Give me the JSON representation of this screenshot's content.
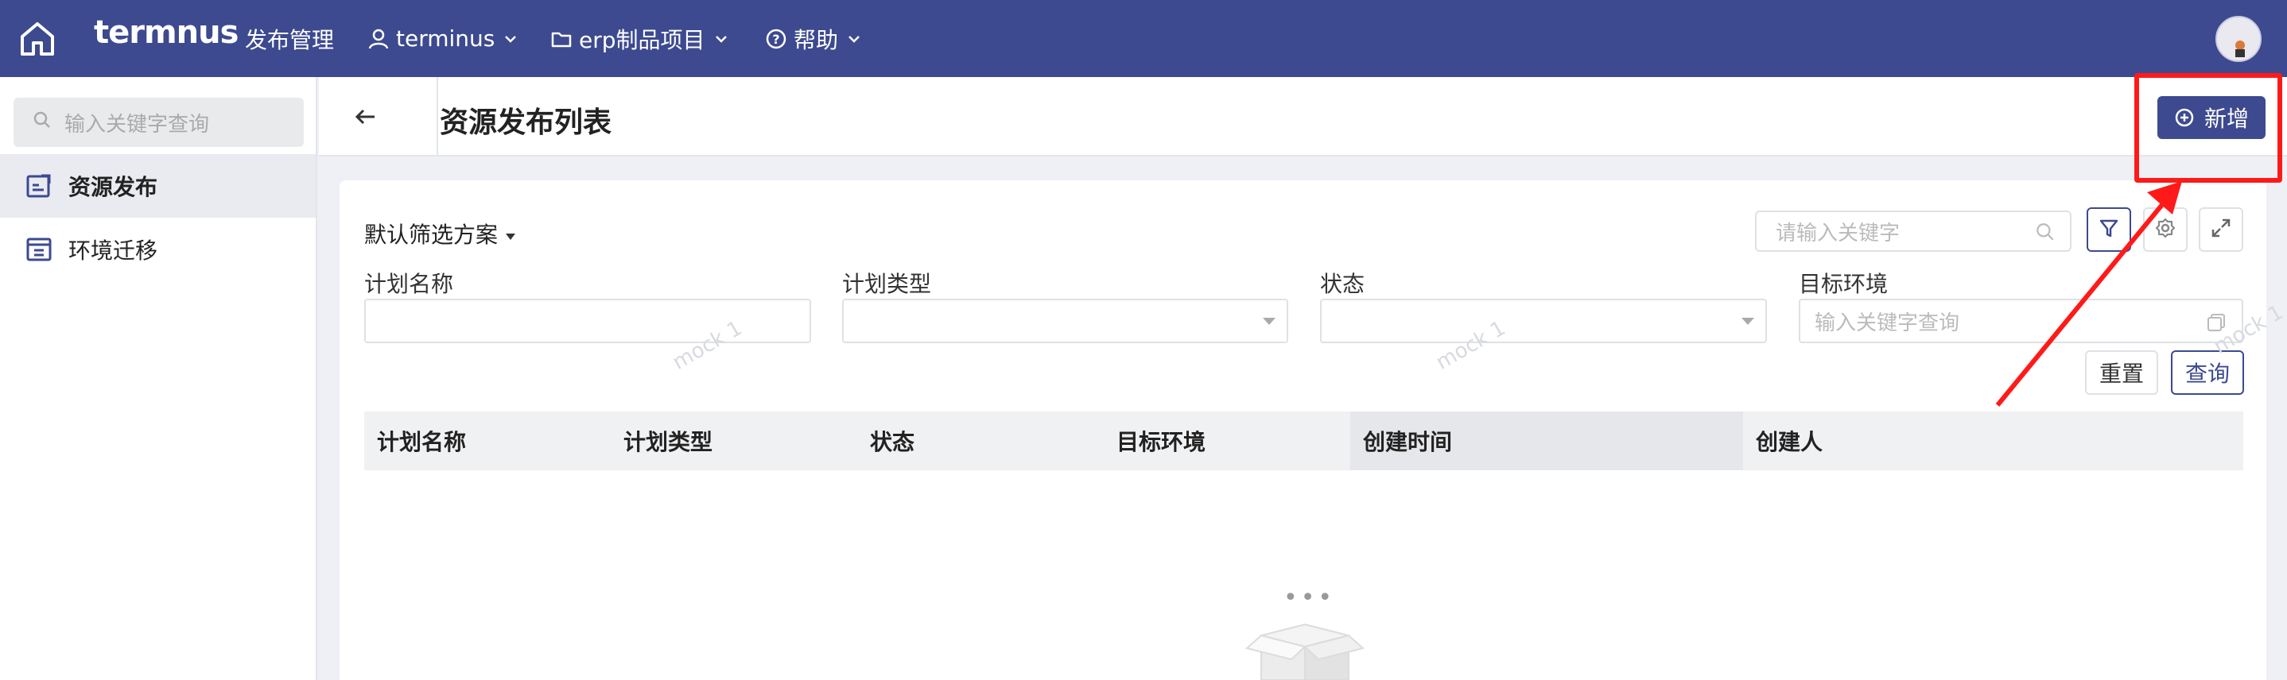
{
  "topbar": {
    "logo": "termnus",
    "section_title": "发布管理",
    "org_label": "terminus",
    "project_label": "erp制品项目",
    "help_label": "帮助"
  },
  "sidebar": {
    "search_placeholder": "输入关键字查询",
    "items": [
      {
        "label": "资源发布",
        "active": true
      },
      {
        "label": "环境迁移",
        "active": false
      }
    ]
  },
  "header": {
    "page_title": "资源发布列表",
    "add_button": "新增"
  },
  "filters": {
    "scheme_label": "默认筛选方案",
    "keyword_placeholder": "请输入关键字",
    "fields": [
      {
        "label": "计划名称",
        "type": "text",
        "placeholder": ""
      },
      {
        "label": "计划类型",
        "type": "select",
        "placeholder": ""
      },
      {
        "label": "状态",
        "type": "select",
        "placeholder": ""
      },
      {
        "label": "目标环境",
        "type": "picker",
        "placeholder": "输入关键字查询"
      }
    ],
    "reset_button": "重置",
    "query_button": "查询"
  },
  "table": {
    "columns": [
      "计划名称",
      "计划类型",
      "状态",
      "目标环境",
      "创建时间",
      "创建人"
    ],
    "rows": []
  },
  "empty_state": {
    "dots": "•••"
  },
  "watermarks": [
    "mock 1",
    "mock 1",
    "mock 1"
  ],
  "colors": {
    "primary": "#3d4a8f",
    "annotation": "#ff1a1a",
    "sidebar_active_bg": "#e9ebf1"
  }
}
